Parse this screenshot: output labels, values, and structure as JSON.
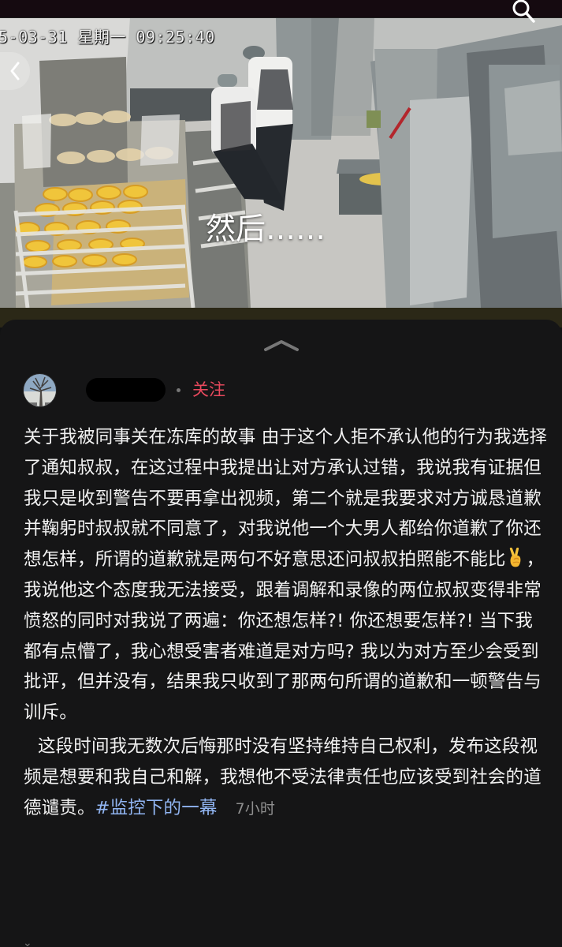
{
  "video": {
    "timestamp": "5-03-31 星期一 09:25:40",
    "caption": "然后……"
  },
  "icons": {
    "back": "chevron-left-icon",
    "search": "search-icon",
    "collapse": "chevron-up-icon",
    "victory": "victory-hand-icon"
  },
  "author": {
    "follow_label": "关注"
  },
  "post": {
    "paragraph1_part1": "关于我被同事关在冻库的故事 由于这个人拒不承认他的行为我选择了通知叔叔，在这过程中我提出让对方承认过错，我说我有证据但我只是收到警告不要再拿出视频，第二个就是我要求对方诚恳道歉并鞠躬时叔叔就不同意了，对我说他一个大男人都给你道歉了你还想怎样，所谓的道歉就是两句不好意思还问叔叔拍照能不能比",
    "paragraph1_part2": "，我说他这个态度我无法接受，跟着调解和录像的两位叔叔变得非常愤怒的同时对我说了两遍：你还想怎样?! 你还想要怎样?! 当下我都有点懵了，我心想受害者难道是对方吗? 我以为对方至少会受到批评，但并没有，结果我只收到了那两句所谓的道歉和一顿警告与训斥。",
    "paragraph2": "这段时间我无数次后悔那时没有坚持维持自己权利，发布这段视频是想要和我自己和解，我想他不受法律责任也应该受到社会的道德谴责。",
    "hashtag": "#监控下的一幕",
    "time_ago": "7小时"
  },
  "colors": {
    "background": "#151516",
    "text": "#f1f1f1",
    "follow": "#e8495d",
    "hashtag": "#91b5f2",
    "muted": "#8f8f8f"
  }
}
